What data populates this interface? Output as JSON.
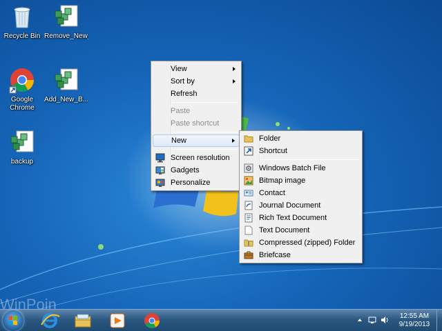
{
  "colors": {
    "desktop": "#1565b8",
    "menu_bg": "#f0f0f0",
    "menu_highlight": "#dbe8f7",
    "taskbar": "#2c5881"
  },
  "desktop_icons": [
    {
      "label": "Recycle Bin",
      "icon": "recycle-bin-icon"
    },
    {
      "label": "Remove_New_...",
      "icon": "registry-script-icon"
    },
    {
      "label": "Google Chrome",
      "line1": "Google",
      "line2": "Chrome",
      "icon": "chrome-icon"
    },
    {
      "label": "Add_New_B...",
      "icon": "registry-script-icon"
    },
    {
      "label": "backup",
      "icon": "registry-script-icon"
    }
  ],
  "context_menu": {
    "view": "View",
    "sort_by": "Sort by",
    "refresh": "Refresh",
    "paste": "Paste",
    "paste_shortcut": "Paste shortcut",
    "new": "New",
    "screen_resolution": "Screen resolution",
    "gadgets": "Gadgets",
    "personalize": "Personalize"
  },
  "new_submenu": {
    "folder": "Folder",
    "shortcut": "Shortcut",
    "batch_file": "Windows Batch File",
    "bitmap": "Bitmap image",
    "contact": "Contact",
    "journal": "Journal Document",
    "rich_text": "Rich Text Document",
    "text_doc": "Text Document",
    "compressed": "Compressed (zipped) Folder",
    "briefcase": "Briefcase"
  },
  "watermark": "WinPoin",
  "taskbar": {
    "pinned": [
      "internet-explorer-icon",
      "windows-explorer-icon",
      "media-player-icon",
      "chrome-icon"
    ],
    "tray_time": "12:55 AM",
    "tray_date": "9/19/2013"
  }
}
